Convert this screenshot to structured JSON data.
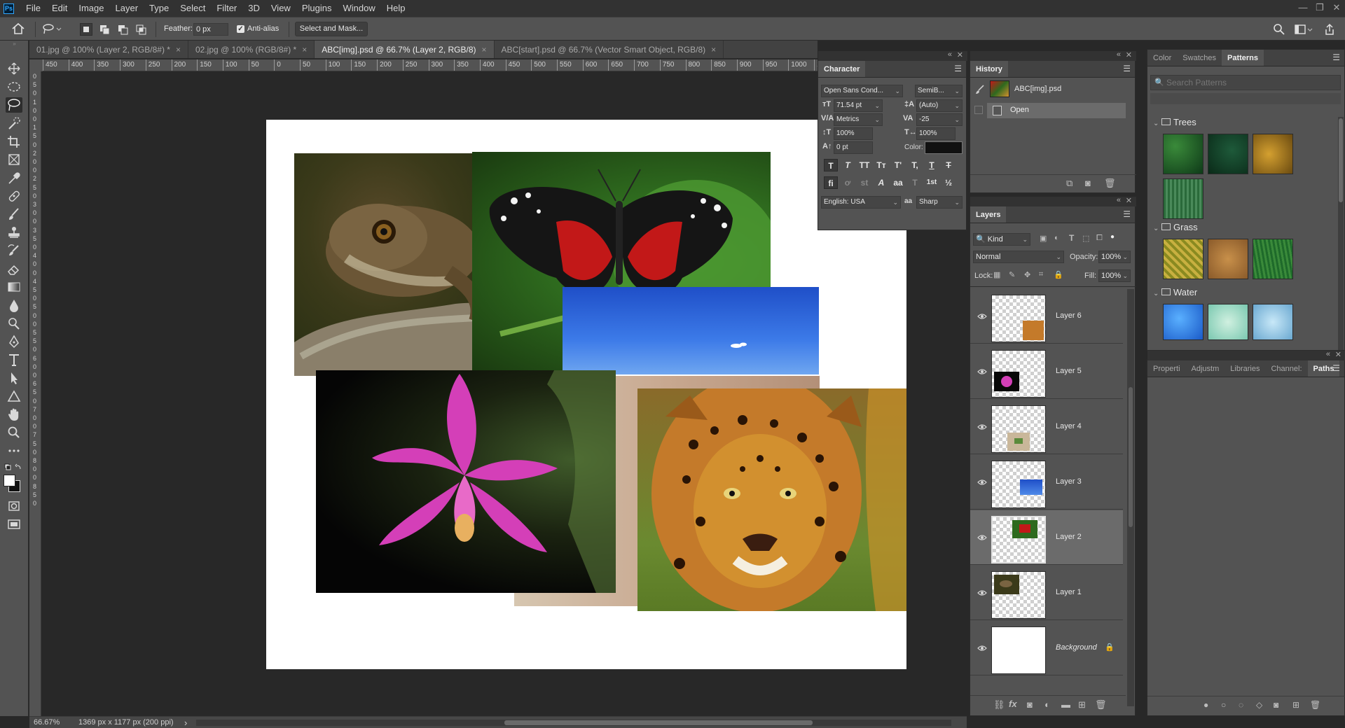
{
  "app": {
    "logo": "Ps"
  },
  "menu": [
    "File",
    "Edit",
    "Image",
    "Layer",
    "Type",
    "Select",
    "Filter",
    "3D",
    "View",
    "Plugins",
    "Window",
    "Help"
  ],
  "window_controls": {
    "minimize": "—",
    "restore": "❐",
    "close": "✕"
  },
  "options_bar": {
    "feather_label": "Feather:",
    "feather_value": "0 px",
    "antialias_label": "Anti-alias",
    "antialias_checked": true,
    "select_mask_label": "Select and Mask..."
  },
  "tabs": [
    {
      "label": "01.jpg @ 100% (Layer 2, RGB/8#) *",
      "active": false
    },
    {
      "label": "02.jpg @ 100% (RGB/8#) *",
      "active": false
    },
    {
      "label": "ABC[img].psd @ 66.7% (Layer 2, RGB/8)",
      "active": true
    },
    {
      "label": "ABC[start].psd @ 66.7% (Vector Smart Object, RGB/8)",
      "active": false
    }
  ],
  "tab_close": "×",
  "ruler_h": [
    "450",
    "400",
    "350",
    "300",
    "250",
    "200",
    "150",
    "100",
    "50",
    "0",
    "50",
    "100",
    "150",
    "200",
    "250",
    "300",
    "350",
    "400",
    "450",
    "500",
    "550",
    "600",
    "650",
    "700",
    "750",
    "800",
    "850",
    "900",
    "950",
    "1000",
    "1050"
  ],
  "ruler_v": [
    "0",
    "5",
    "0",
    "1",
    "0",
    "0",
    "1",
    "5",
    "0",
    "2",
    "0",
    "0",
    "2",
    "5",
    "0",
    "3",
    "0",
    "0",
    "3",
    "5",
    "0",
    "4",
    "0",
    "0",
    "4",
    "5",
    "0",
    "5",
    "0",
    "0",
    "5",
    "5",
    "0",
    "6",
    "0",
    "0",
    "6",
    "5",
    "0",
    "7",
    "0",
    "0",
    "7",
    "5",
    "0",
    "8",
    "0",
    "0",
    "8",
    "5",
    "0"
  ],
  "status": {
    "zoom": "66.67%",
    "doc_size": "1369 px x 1177 px (200 ppi)",
    "arrow": "›"
  },
  "character": {
    "title": "Character",
    "font_family": "Open Sans Cond...",
    "font_style": "SemiB...",
    "size": "71.54 pt",
    "leading": "(Auto)",
    "kerning": "Metrics",
    "tracking": "-25",
    "vscale": "100%",
    "hscale": "100%",
    "baseline": "0 pt",
    "color_label": "Color:",
    "color": "#111111",
    "language": "English: USA",
    "aa_icon": "aa",
    "antialias": "Sharp",
    "styles_row1": [
      "T",
      "T",
      "TT",
      "Tт",
      "T'",
      "T,",
      "T",
      "T"
    ],
    "styles_row2": [
      "fi",
      "ơ",
      "st",
      "A",
      "aa",
      "T",
      "1st",
      "½"
    ]
  },
  "history": {
    "title": "History",
    "snapshot": "ABC[img].psd",
    "items": [
      "Open"
    ]
  },
  "layers": {
    "title": "Layers",
    "filter": "Kind",
    "blend_mode": "Normal",
    "opacity_label": "Opacity:",
    "opacity": "100%",
    "lock_label": "Lock:",
    "fill_label": "Fill:",
    "fill": "100%",
    "items": [
      {
        "name": "Layer 6",
        "selected": false
      },
      {
        "name": "Layer 5",
        "selected": false
      },
      {
        "name": "Layer 4",
        "selected": false
      },
      {
        "name": "Layer 3",
        "selected": false
      },
      {
        "name": "Layer 2",
        "selected": true
      },
      {
        "name": "Layer 1",
        "selected": false
      },
      {
        "name": "Background",
        "selected": false
      }
    ]
  },
  "patterns_panel": {
    "tabs": [
      "Color",
      "Swatches",
      "Patterns"
    ],
    "active": "Patterns",
    "search_placeholder": "Search Patterns",
    "groups": [
      "Trees",
      "Grass",
      "Water"
    ]
  },
  "properties_panel": {
    "tabs": [
      "Properti",
      "Adjustm",
      "Libraries",
      "Channel:",
      "Paths"
    ],
    "active": "Paths"
  },
  "colors": {
    "accent": "#31a8ff",
    "panel": "#535353",
    "canvas_bg": "#282828"
  }
}
